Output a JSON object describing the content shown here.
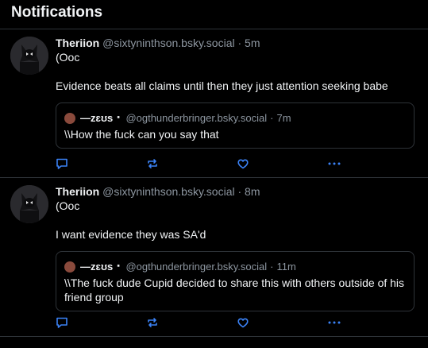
{
  "header": {
    "title": "Notifications"
  },
  "posts": [
    {
      "author_name": "Theriion",
      "author_handle": "@sixtyninthson.bsky.social",
      "separator": "·",
      "time": "5m",
      "line1": "(Ooc",
      "line2": "Evidence beats all claims until then they just attention seeking babe",
      "quote": {
        "name": "—zɛʊs⠐",
        "handle": "@ogthunderbringer.bsky.social",
        "separator": "·",
        "time": "7m",
        "text": "\\\\How the fuck can you say that"
      }
    },
    {
      "author_name": "Theriion",
      "author_handle": "@sixtyninthson.bsky.social",
      "separator": "·",
      "time": "8m",
      "line1": "(Ooc",
      "line2": "I want evidence they was SA'd",
      "quote": {
        "name": "—zɛʊs⠐",
        "handle": "@ogthunderbringer.bsky.social",
        "separator": "·",
        "time": "11m",
        "text": "\\\\The fuck dude Cupid decided to share this with others outside of his friend group"
      }
    }
  ],
  "icons": {
    "reply": "reply-icon",
    "repost": "repost-icon",
    "like": "heart-icon",
    "more": "more-icon"
  },
  "colors": {
    "background": "#000000",
    "text": "#f1f3f5",
    "muted": "#8d96a0",
    "icon_blue": "#3b82f6",
    "border": "#2e3338"
  }
}
